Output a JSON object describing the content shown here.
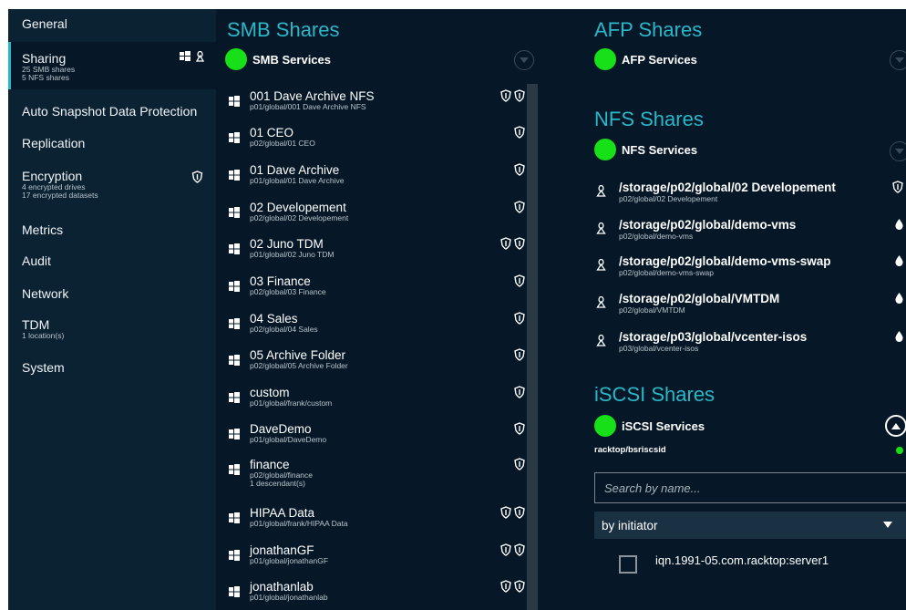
{
  "sidebar": {
    "items": [
      {
        "label": "General",
        "sub": []
      },
      {
        "label": "Sharing",
        "sub": [
          "25 SMB shares",
          "5 NFS shares"
        ]
      },
      {
        "label": "Auto Snapshot Data Protection",
        "sub": []
      },
      {
        "label": "Replication",
        "sub": []
      },
      {
        "label": "Encryption",
        "sub": [
          "4 encrypted drives",
          "17 encrypted datasets"
        ]
      },
      {
        "label": "Metrics",
        "sub": []
      },
      {
        "label": "Audit",
        "sub": []
      },
      {
        "label": "Network",
        "sub": []
      },
      {
        "label": "TDM",
        "sub": [
          "1 location(s)"
        ]
      },
      {
        "label": "System",
        "sub": []
      }
    ]
  },
  "smb": {
    "title": "SMB Shares",
    "service_label": "SMB Services",
    "rows": [
      {
        "name": "001 Dave Archive NFS",
        "path": "p01/global/001 Dave Archive NFS",
        "shields": 2
      },
      {
        "name": "01 CEO",
        "path": "p02/global/01 CEO",
        "shields": 1
      },
      {
        "name": "01 Dave Archive",
        "path": "p01/global/01 Dave Archive",
        "shields": 1
      },
      {
        "name": "02 Developement",
        "path": "p02/global/02 Developement",
        "shields": 1
      },
      {
        "name": "02 Juno TDM",
        "path": "p01/global/02 Juno TDM",
        "shields": 2
      },
      {
        "name": "03 Finance",
        "path": "p02/global/03 Finance",
        "shields": 1
      },
      {
        "name": "04 Sales",
        "path": "p02/global/04 Sales",
        "shields": 1
      },
      {
        "name": "05 Archive Folder",
        "path": "p02/global/05 Archive Folder",
        "shields": 1
      },
      {
        "name": "custom",
        "path": "p01/global/frank/custom",
        "shields": 1
      },
      {
        "name": "DaveDemo",
        "path": "p01/global/DaveDemo",
        "shields": 1
      },
      {
        "name": "finance",
        "path": "p02/global/finance",
        "extra": "1 descendant(s)",
        "shields": 1
      },
      {
        "name": "HIPAA Data",
        "path": "p01/global/frank/HIPAA Data",
        "shields": 2
      },
      {
        "name": "jonathanGF",
        "path": "p01/global/jonathanGF",
        "shields": 2
      },
      {
        "name": "jonathanlab",
        "path": "p01/global/jonathanlab",
        "shields": 2
      }
    ]
  },
  "afp": {
    "title": "AFP Shares",
    "service_label": "AFP Services"
  },
  "nfs": {
    "title": "NFS Shares",
    "service_label": "NFS Services",
    "rows": [
      {
        "name": "/storage/p02/global/02 Developement",
        "path": "p02/global/02 Developement",
        "icon": "shield-icon"
      },
      {
        "name": "/storage/p02/global/demo-vms",
        "path": "p02/global/demo-vms",
        "icon": "drop-icon"
      },
      {
        "name": "/storage/p02/global/demo-vms-swap",
        "path": "p02/global/demo-vms-swap",
        "icon": "drop-icon"
      },
      {
        "name": "/storage/p02/global/VMTDM",
        "path": "p02/global/VMTDM",
        "icon": "drop-icon"
      },
      {
        "name": "/storage/p03/global/vcenter-isos",
        "path": "p03/global/vcenter-isos",
        "icon": "drop-icon"
      }
    ]
  },
  "iscsi": {
    "title": "iSCSI Shares",
    "service_label": "iSCSI Services",
    "target": "racktop/bsriscsid",
    "search_placeholder": "Search by name...",
    "filter_value": "by initiator",
    "initiator": "iqn.1991-05.com.racktop:server1",
    "initiator_checked": false
  },
  "colors": {
    "accent": "#2ab7c9",
    "status_green": "#18e018",
    "background": "#061827",
    "sidebar": "#0b2233"
  }
}
